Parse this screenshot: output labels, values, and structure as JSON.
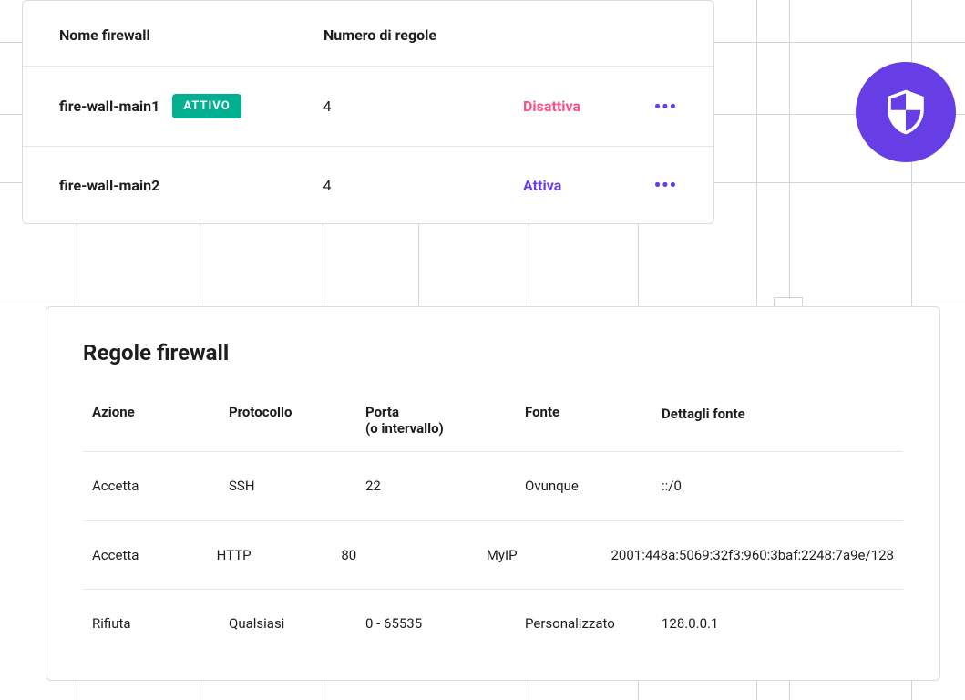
{
  "firewall_list": {
    "headers": {
      "name": "Nome firewall",
      "rules": "Numero di regole"
    },
    "rows": [
      {
        "name": "fire-wall-main1",
        "status_badge": "ATTIVO",
        "rule_count": "4",
        "action_label": "Disattiva",
        "action_kind": "disable"
      },
      {
        "name": "fire-wall-main2",
        "status_badge": "",
        "rule_count": "4",
        "action_label": "Attiva",
        "action_kind": "enable"
      }
    ]
  },
  "rules_panel": {
    "title": "Regole firewall",
    "headers": {
      "action": "Azione",
      "protocol": "Protocollo",
      "port": "Porta\n(o intervallo)",
      "source": "Fonte",
      "details": "Dettagli fonte"
    },
    "rows": [
      {
        "action": "Accetta",
        "protocol": "SSH",
        "port": "22",
        "source": "Ovunque",
        "details": "::/0"
      },
      {
        "action": "Accetta",
        "protocol": "HTTP",
        "port": "80",
        "source": "MyIP",
        "details": "2001:448a:5069:32f3:960:3baf:2248:7a9e/128"
      },
      {
        "action": "Rifiuta",
        "protocol": "Qualsiasi",
        "port": "0 - 65535",
        "source": "Personalizzato",
        "details": "128.0.0.1"
      }
    ]
  },
  "icon_name": "shield-icon",
  "colors": {
    "primary": "#673de6",
    "success": "#00b090",
    "danger": "#fc5185"
  }
}
